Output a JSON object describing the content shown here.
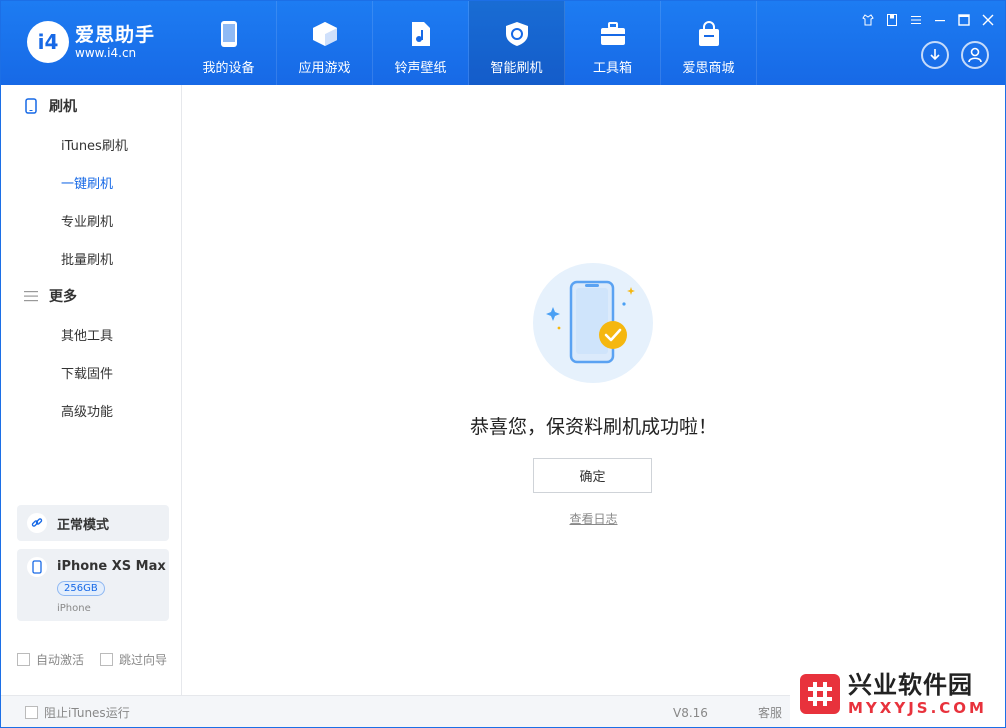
{
  "app": {
    "name": "爱思助手",
    "url": "www.i4.cn",
    "logo_glyph": "i4"
  },
  "nav": {
    "items": [
      {
        "label": "我的设备",
        "icon": "phone-icon"
      },
      {
        "label": "应用游戏",
        "icon": "cube-icon"
      },
      {
        "label": "铃声壁纸",
        "icon": "music-file-icon"
      },
      {
        "label": "智能刷机",
        "icon": "refresh-shield-icon"
      },
      {
        "label": "工具箱",
        "icon": "toolbox-icon"
      },
      {
        "label": "爱思商城",
        "icon": "shopping-bag-icon"
      }
    ],
    "active_index": 3
  },
  "sidebar": {
    "group1": {
      "label": "刷机"
    },
    "items1": [
      "iTunes刷机",
      "一键刷机",
      "专业刷机",
      "批量刷机"
    ],
    "active_item": "一键刷机",
    "group2": {
      "label": "更多"
    },
    "items2": [
      "其他工具",
      "下载固件",
      "高级功能"
    ],
    "mode": "正常模式",
    "device": {
      "name": "iPhone XS Max",
      "capacity": "256GB",
      "type": "iPhone"
    },
    "options": [
      "自动激活",
      "跳过向导"
    ]
  },
  "main": {
    "message": "恭喜您，保资料刷机成功啦！",
    "confirm_label": "确定",
    "log_link": "查看日志"
  },
  "footer": {
    "itunes_option": "阻止iTunes运行",
    "version": "V8.16",
    "service": "客服"
  },
  "watermark": {
    "cn": "兴业软件园",
    "en": "MYXYJS.COM"
  },
  "colors": {
    "brand": "#1769e6",
    "success": "#f5b70f"
  }
}
